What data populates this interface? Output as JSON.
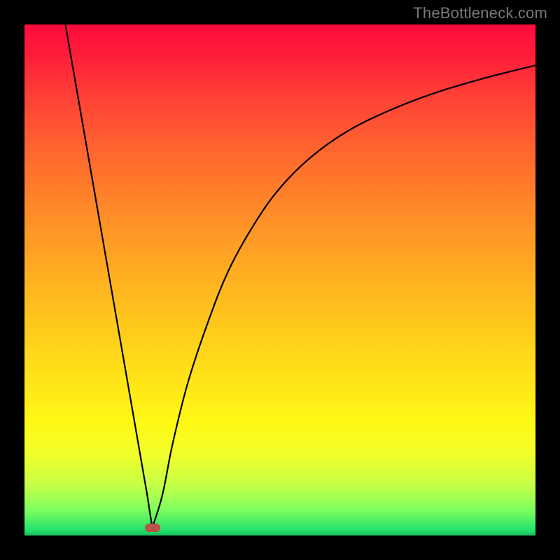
{
  "watermark": "TheBottleneck.com",
  "chart_data": {
    "type": "line",
    "title": "",
    "xlabel": "",
    "ylabel": "",
    "xlim": [
      0,
      100
    ],
    "ylim": [
      0,
      100
    ],
    "grid": false,
    "annotations": [
      {
        "type": "marker",
        "x": 25,
        "y": 1.5,
        "shape": "rounded-rect",
        "color": "#b9534b"
      }
    ],
    "series": [
      {
        "name": "left-branch",
        "x": [
          8,
          12,
          16,
          20,
          24,
          25
        ],
        "values": [
          100,
          77,
          54,
          31,
          8,
          1.5
        ]
      },
      {
        "name": "right-branch",
        "x": [
          25,
          27,
          29,
          32,
          36,
          40,
          45,
          50,
          56,
          63,
          71,
          80,
          90,
          100
        ],
        "values": [
          1.5,
          8,
          18,
          30,
          42,
          52,
          61,
          68,
          74,
          79,
          83,
          86.5,
          89.5,
          92
        ]
      }
    ],
    "background_gradient": {
      "top": "#ff0a3c",
      "bottom": "#18c060"
    }
  }
}
